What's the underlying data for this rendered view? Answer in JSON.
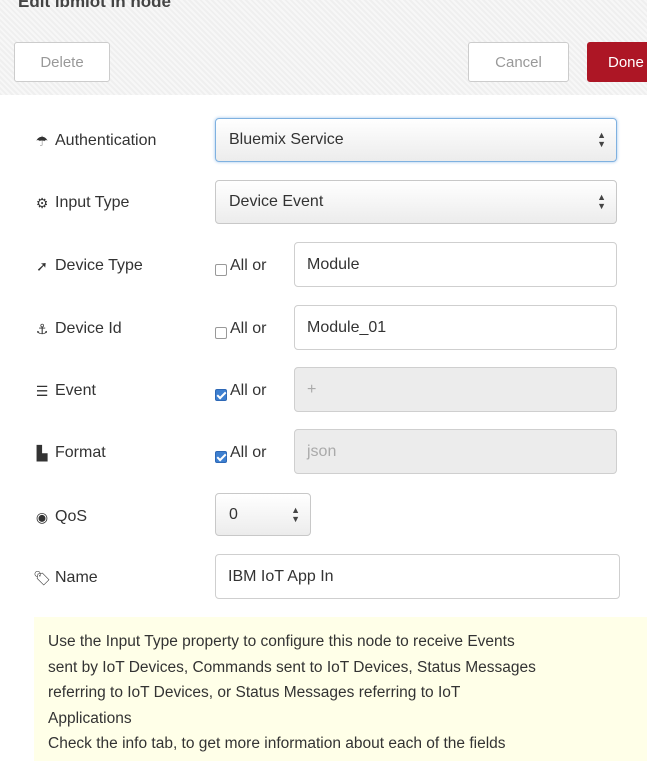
{
  "dialog": {
    "title": "Edit ibmiot in node",
    "delete_label": "Delete",
    "cancel_label": "Cancel",
    "done_label": "Done"
  },
  "form": {
    "authentication": {
      "label": "Authentication",
      "icon": "umbrella-icon",
      "value": "Bluemix Service"
    },
    "input_type": {
      "label": "Input Type",
      "icon": "cogs-icon",
      "value": "Device Event"
    },
    "device_type": {
      "label": "Device Type",
      "icon": "rocket-icon",
      "all_label": "All or",
      "all_checked": false,
      "value": "Module"
    },
    "device_id": {
      "label": "Device Id",
      "icon": "anchor-icon",
      "all_label": "All or",
      "all_checked": false,
      "value": "Module_01"
    },
    "event": {
      "label": "Event",
      "icon": "tasks-icon",
      "all_label": "All or",
      "all_checked": true,
      "value": "+"
    },
    "format": {
      "label": "Format",
      "icon": "file-icon",
      "all_label": "All or",
      "all_checked": true,
      "value": "json"
    },
    "qos": {
      "label": "QoS",
      "icon": "radio-icon",
      "value": "0"
    },
    "name": {
      "label": "Name",
      "icon": "tag-icon",
      "value": "IBM IoT App In"
    }
  },
  "tip": {
    "lines": [
      "Use the Input Type property to configure this node to receive Events",
      "sent by IoT Devices, Commands sent to IoT Devices, Status Messages",
      "referring to IoT Devices, or Status Messages referring to IoT",
      "Applications",
      "Check the info tab, to get more information about each of the fields"
    ]
  },
  "colors": {
    "done_button": "#ad1625",
    "checkbox_on": "#3d7fd0",
    "tip_background": "#ffffe8"
  }
}
